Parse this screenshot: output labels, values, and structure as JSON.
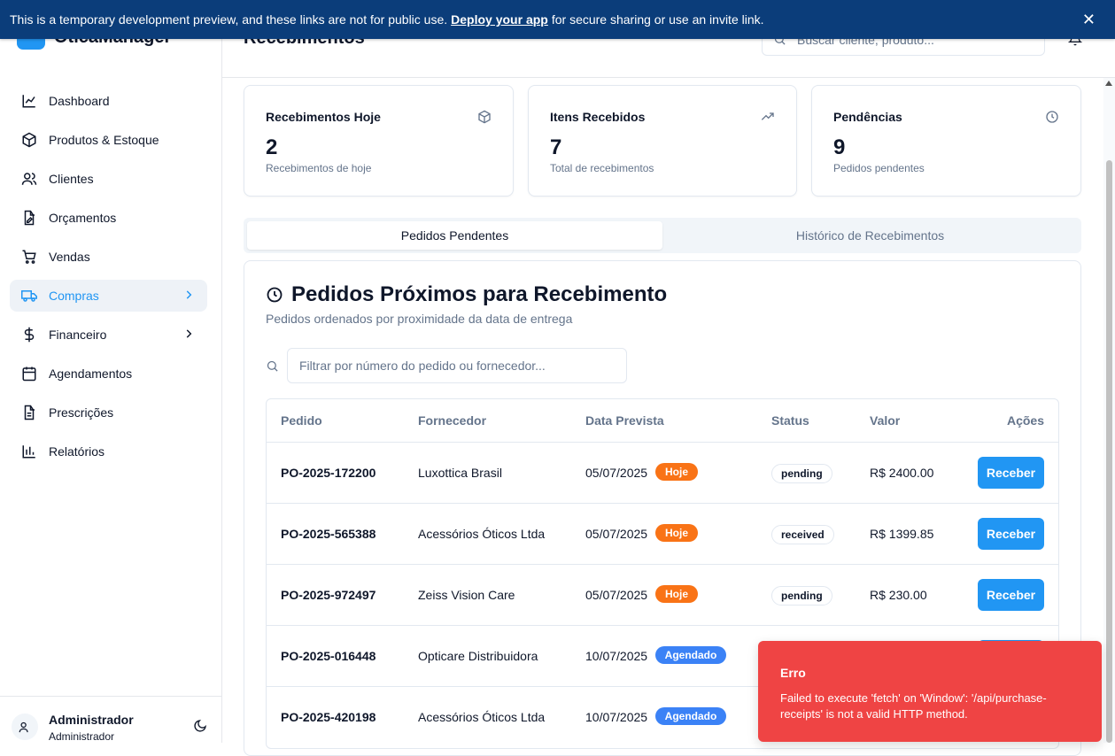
{
  "banner": {
    "text_before": "This is a temporary development preview, and these links are not for public use.",
    "link": "Deploy your app",
    "text_after": "for secure sharing or use an invite link.",
    "close": "✕"
  },
  "app": {
    "name": "OticaManager"
  },
  "sidebar": {
    "items": [
      {
        "label": "Dashboard",
        "icon": "chart-line-icon"
      },
      {
        "label": "Produtos & Estoque",
        "icon": "package-icon"
      },
      {
        "label": "Clientes",
        "icon": "users-icon"
      },
      {
        "label": "Orçamentos",
        "icon": "file-edit-icon"
      },
      {
        "label": "Vendas",
        "icon": "cart-icon"
      },
      {
        "label": "Compras",
        "icon": "truck-icon",
        "active": true,
        "has_chevron": true
      },
      {
        "label": "Financeiro",
        "icon": "dollar-icon",
        "has_chevron": true
      },
      {
        "label": "Agendamentos",
        "icon": "calendar-icon"
      },
      {
        "label": "Prescrições",
        "icon": "file-text-icon"
      },
      {
        "label": "Relatórios",
        "icon": "bar-chart-icon"
      }
    ],
    "user": {
      "name": "Administrador",
      "role": "Administrador"
    }
  },
  "header": {
    "title": "Recebimentos",
    "search_placeholder": "Buscar cliente, produto..."
  },
  "stats": [
    {
      "title": "Recebimentos Hoje",
      "value": "2",
      "sub": "Recebimentos de hoje",
      "icon": "package-icon"
    },
    {
      "title": "Itens Recebidos",
      "value": "7",
      "sub": "Total de recebimentos",
      "icon": "trending-up-icon"
    },
    {
      "title": "Pendências",
      "value": "9",
      "sub": "Pedidos pendentes",
      "icon": "clock-icon"
    }
  ],
  "tabs": {
    "active": "Pedidos Pendentes",
    "inactive": "Histórico de Recebimentos"
  },
  "panel": {
    "title": "Pedidos Próximos para Recebimento",
    "subtitle": "Pedidos ordenados por proximidade da data de entrega",
    "filter_placeholder": "Filtrar por número do pedido ou fornecedor..."
  },
  "table": {
    "headers": {
      "order": "Pedido",
      "supplier": "Fornecedor",
      "date": "Data Prevista",
      "status": "Status",
      "value": "Valor",
      "actions": "Ações"
    },
    "rows": [
      {
        "order": "PO-2025-172200",
        "supplier": "Luxottica Brasil",
        "date": "05/07/2025",
        "tag": "Hoje",
        "status": "pending",
        "value": "R$ 2400.00",
        "action": "Receber"
      },
      {
        "order": "PO-2025-565388",
        "supplier": "Acessórios Óticos Ltda",
        "date": "05/07/2025",
        "tag": "Hoje",
        "status": "received",
        "value": "R$ 1399.85",
        "action": "Receber"
      },
      {
        "order": "PO-2025-972497",
        "supplier": "Zeiss Vision Care",
        "date": "05/07/2025",
        "tag": "Hoje",
        "status": "pending",
        "value": "R$ 230.00",
        "action": "Receber"
      },
      {
        "order": "PO-2025-016448",
        "supplier": "Opticare Distribuidora",
        "date": "10/07/2025",
        "tag": "Agendado",
        "status": "",
        "value": "",
        "action": ""
      },
      {
        "order": "PO-2025-420198",
        "supplier": "Acessórios Óticos Ltda",
        "date": "10/07/2025",
        "tag": "Agendado",
        "status": "",
        "value": "",
        "action": ""
      }
    ]
  },
  "toast": {
    "title": "Erro",
    "message": "Failed to execute 'fetch' on 'Window': '/api/purchase-receipts' is not a valid HTTP method."
  },
  "colors": {
    "primary": "#2196f3",
    "today": "#f97316",
    "scheduled": "#3b82f6",
    "error": "#ef4444",
    "banner": "#0b3d7a"
  }
}
